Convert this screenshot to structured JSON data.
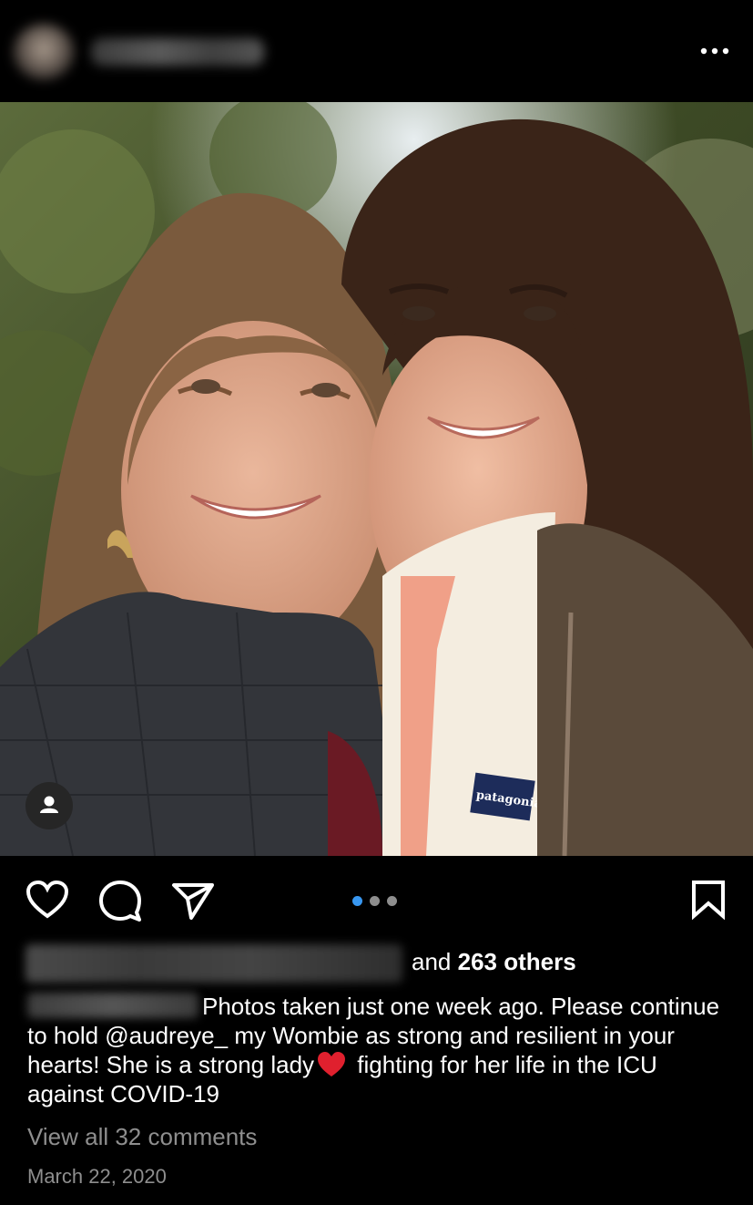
{
  "post": {
    "header": {
      "username": "",
      "more_icon": "more-horizontal-icon"
    },
    "photo": {
      "alt": "Two smiling women taking a selfie outdoors",
      "jacket_logo": "patagonia"
    },
    "carousel": {
      "count": 3,
      "active_index": 0
    },
    "colors": {
      "background": "#000000",
      "carousel_active": "#3897f0",
      "carousel_inactive": "#8e8e8e",
      "muted_text": "#8e8e8e",
      "heart_emoji": "#e0202e"
    },
    "likes": {
      "prefix": "and",
      "count_text": "263 others"
    },
    "caption": {
      "part1": "Photos taken just one week ago. Please continue to hold @audreye_ my Wombie as strong and resilient in your hearts! She is a strong lady",
      "part2": " fighting for her life in the ICU against COVID-19"
    },
    "comments_link": "View all 32 comments",
    "date": "March 22, 2020"
  }
}
